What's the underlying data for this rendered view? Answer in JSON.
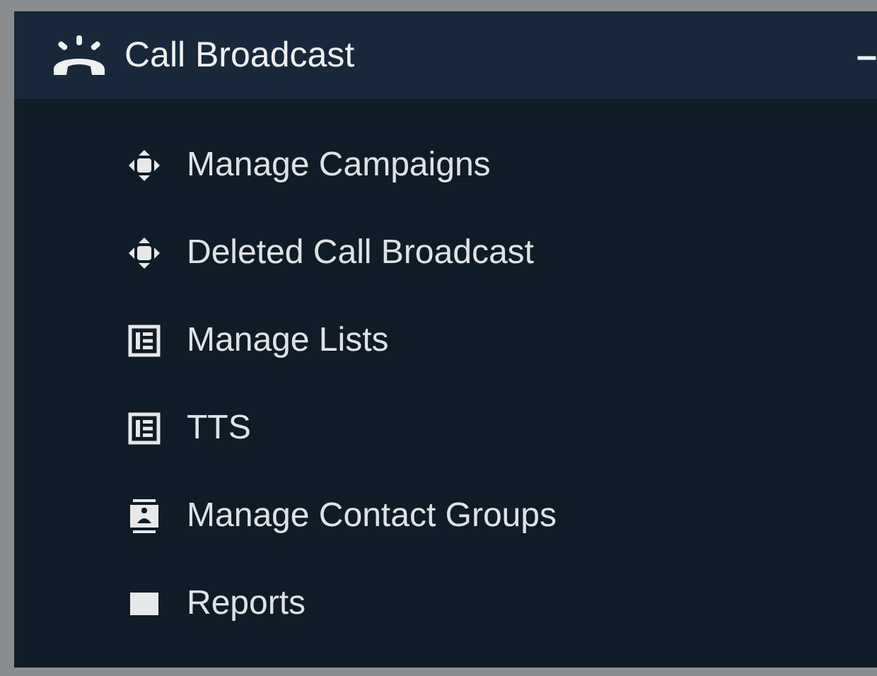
{
  "menu": {
    "title": "Call Broadcast",
    "toggle": "–",
    "items": [
      {
        "label": "Manage Campaigns",
        "kind": "move"
      },
      {
        "label": "Deleted Call Broadcast",
        "kind": "move"
      },
      {
        "label": "Manage Lists",
        "kind": "table"
      },
      {
        "label": "TTS",
        "kind": "table"
      },
      {
        "label": "Manage Contact Groups",
        "kind": "contact"
      },
      {
        "label": "Reports",
        "kind": "block"
      }
    ]
  }
}
